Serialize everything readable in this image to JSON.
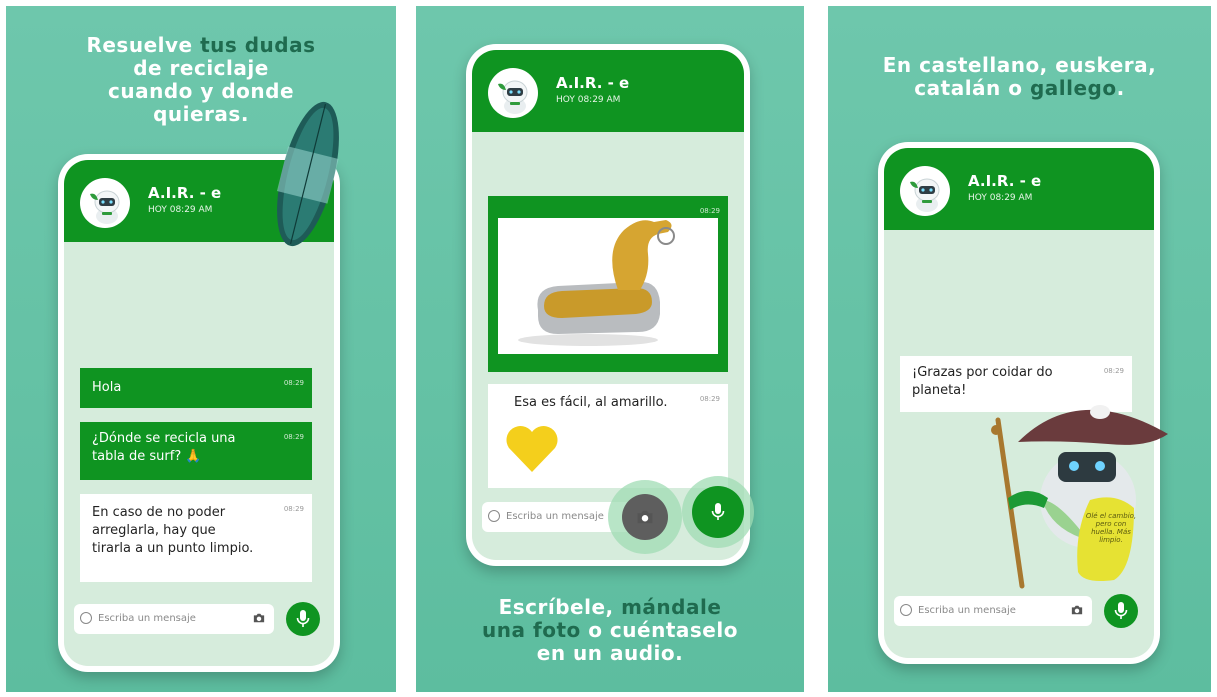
{
  "colors": {
    "panel_bg": "#63c1a4",
    "brand_green": "#0f9421",
    "chat_bg": "#d6ecdc",
    "caption_accent": "#1f6b4f"
  },
  "chat": {
    "name": "A.I.R. - e",
    "status": "HOY 08:29 AM",
    "input_placeholder": "Escriba un mensaje",
    "avatar_icon": "robot-icon"
  },
  "panel1": {
    "caption": {
      "w1": "Resuelve",
      "w2": "tus dudas",
      "w3": "de reciclaje",
      "w4": "cuando y donde",
      "w5": "quieras."
    },
    "messages": [
      {
        "text": "Hola",
        "time": "08:29"
      },
      {
        "text": "¿Dónde se recicla una tabla de surf? 🙏",
        "time": "08:29"
      },
      {
        "text": "En caso de no poder arreglarla, hay que tirarla a un punto limpio.",
        "time": "08:29"
      }
    ]
  },
  "panel2": {
    "image_time": "08:29",
    "reply": {
      "text": "Esa es fácil, al amarillo.",
      "time": "08:29"
    },
    "caption": {
      "w1": "Escríbele,",
      "w2": "mándale",
      "w3": "una",
      "w4": "foto",
      "w5": "o cuéntaselo",
      "w6": "en un audio."
    }
  },
  "panel3": {
    "caption": {
      "w1": "En castellano, euskera,",
      "w2": "catalán o",
      "w3": "gallego",
      "w4": "."
    },
    "message": {
      "text": "¡Grazas por coidar do planeta!",
      "time": "08:29"
    },
    "bag_text": "Olé el cambio, pero con huella. Más limpio."
  }
}
